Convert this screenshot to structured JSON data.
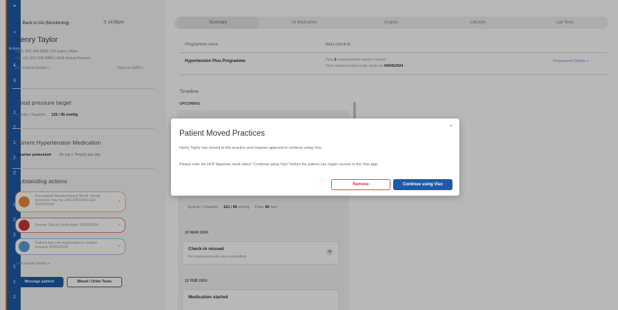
{
  "rail": {
    "section_label": "Actions",
    "numbers": [
      "4",
      "3",
      "1",
      "2",
      "1",
      "2",
      "2",
      "2",
      "2",
      "2",
      "1",
      "1",
      "1"
    ]
  },
  "patient": {
    "back_label": "Back to list (Monitoring)",
    "time": "14:55pm",
    "name": "Henry Taylor",
    "detail1": "NHS: 822 436 5856 | 66 years | Male",
    "detail2": "Tel: +31-812-905-2890 | NHS Actual Practice",
    "details_link": "Edit Patient Details >",
    "emis_link": "Open in EMIS >"
  },
  "bp_target": {
    "title": "Blood pressure target",
    "label": "Systolic / Diastolic",
    "value": "135 / 85 mmHg"
  },
  "medication": {
    "title": "Current Hypertension Medication",
    "name": "Losartan potassium",
    "dose": "50 mg  1 Time(s) per day"
  },
  "actions": {
    "title": "Outstanding actions",
    "items": [
      {
        "line1": "Incomplete Measurement Week: blood",
        "line2": "pressure may be UNCONTROLLED",
        "line3": "15/02/2024"
      },
      {
        "line1": "Severe Out of Limits Alert 15/02/2024",
        "line2": "",
        "line3": ""
      },
      {
        "line1": "Patient has not responded to contact",
        "line2": "request 15/02/2024",
        "line3": ""
      }
    ],
    "history_link": "View action history >",
    "message_button": "Message patient",
    "tests_button": "Blood / Urine Tests"
  },
  "tabs": [
    "Summary",
    "All Medication",
    "Graphs",
    "Lifestyle",
    "Lab Tests"
  ],
  "programme": {
    "header_name": "Programme name",
    "header_next": "Next check-in",
    "name": "Hypertension Plus Programme",
    "missed_prefix": "Past ",
    "missed_count": "3",
    "missed_suffix": " measurement weeks missed",
    "next_prefix": "Next measurement week starts on ",
    "next_date": "04/05/2024",
    "details_link": "Programme Details >"
  },
  "timeline": {
    "title": "Timeline",
    "upcoming": "UPCOMING",
    "reading_label": "Systolic / Diastolic",
    "reading_value": "161 / 85",
    "reading_unit": "mmHg",
    "pulse_label": "Pulse",
    "pulse_value": "80",
    "pulse_unit": "bpm",
    "date1": "22 MAR 2024",
    "event1_title": "Check-in missed",
    "event1_sub": "No measurements were submitted",
    "date2": "12 FEB 2024",
    "event2_title": "Medication started"
  },
  "modal": {
    "title": "Patient Moved Practices",
    "close": "×",
    "body1": "Henry Taylor has moved to this practice and requires approval to continue using Viso.",
    "body2": "Please note: An HCP Approver must select \"Continue using Viso\" before the patient can regain access to the Viso app.",
    "remove_button": "Remove",
    "continue_button": "Continue using Viso"
  },
  "colors": {
    "brand": "#1e5aa8",
    "danger": "#cc3333",
    "alert_orange": "#e8893a",
    "alert_red": "#c8362f",
    "alert_blue": "#5a9fd6"
  }
}
